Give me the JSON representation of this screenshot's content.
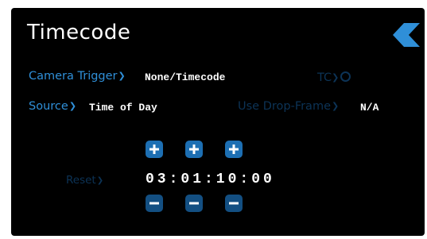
{
  "header": {
    "title": "Timecode"
  },
  "camera_trigger": {
    "label": "Camera Trigger",
    "value": "None/Timecode"
  },
  "tc_indicator": {
    "label": "TC"
  },
  "source": {
    "label": "Source",
    "value": "Time of Day"
  },
  "drop_frame": {
    "label": "Use Drop-Frame",
    "value": "N/A"
  },
  "reset": {
    "label": "Reset"
  },
  "timecode": {
    "value": "03:01:10:00"
  },
  "colors": {
    "background": "#000000",
    "accent": "#2f8fd8",
    "dim_accent": "#0c3356",
    "button": "#1d6fb3",
    "text": "#ffffff"
  },
  "icons": {
    "back": "chevron-left-icon",
    "chevron": "chevron-right-icon",
    "plus": "plus-icon",
    "minus": "minus-icon",
    "indicator": "ring-icon"
  }
}
